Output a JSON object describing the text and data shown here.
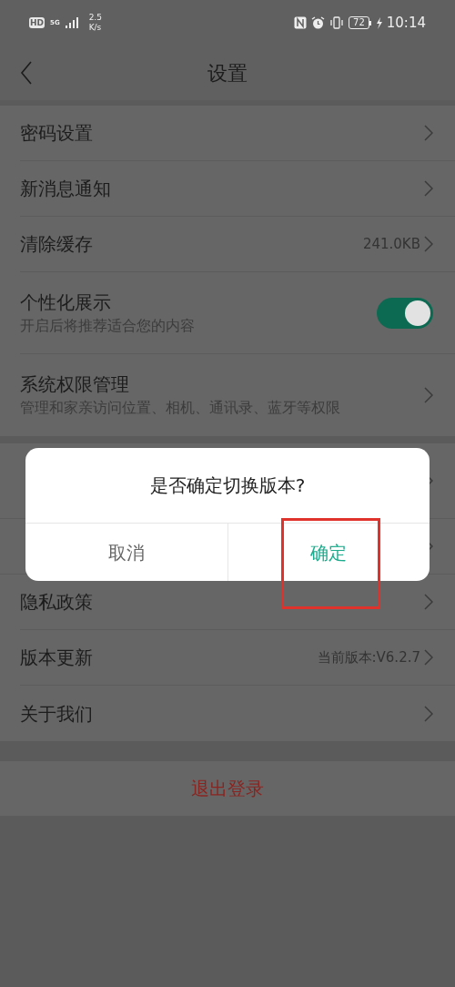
{
  "status_bar": {
    "hd": "HD",
    "network": "5G",
    "speed_value": "2.5",
    "speed_unit": "K/s",
    "battery": "72",
    "time": "10:14"
  },
  "header": {
    "title": "设置"
  },
  "groups": [
    {
      "items": [
        {
          "kind": "link",
          "label": "密码设置"
        },
        {
          "kind": "link",
          "label": "新消息通知"
        },
        {
          "kind": "link",
          "label": "清除缓存",
          "value": "241.0KB"
        },
        {
          "kind": "toggle",
          "label": "个性化展示",
          "subtitle": "开启后将推荐适合您的内容",
          "on": true
        },
        {
          "kind": "link",
          "label": "系统权限管理",
          "subtitle": "管理和家亲访问位置、相机、通讯录、蓝牙等权限"
        }
      ]
    },
    {
      "items": [
        {
          "kind": "covered"
        },
        {
          "kind": "covered"
        },
        {
          "kind": "link",
          "label": "隐私政策"
        },
        {
          "kind": "link",
          "label": "版本更新",
          "value": "当前版本:V6.2.7"
        },
        {
          "kind": "link",
          "label": "关于我们"
        }
      ]
    }
  ],
  "logout": {
    "label": "退出登录"
  },
  "dialog": {
    "message": "是否确定切换版本?",
    "cancel": "取消",
    "confirm": "确定"
  }
}
